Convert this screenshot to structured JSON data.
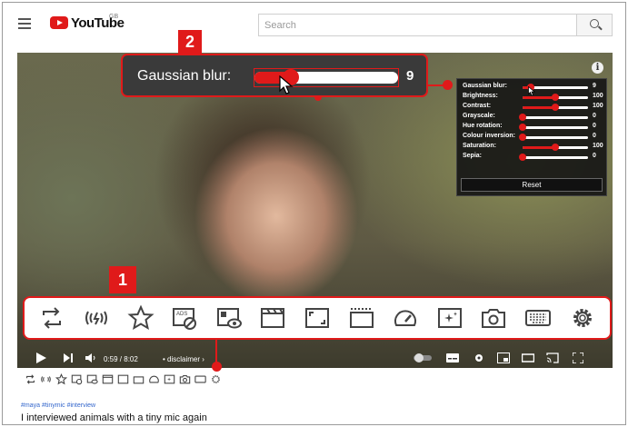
{
  "header": {
    "logo_text": "YouTube",
    "region": "GB",
    "search_placeholder": "Search"
  },
  "callouts": {
    "one": "1",
    "two": "2"
  },
  "blur_callout": {
    "label": "Gaussian blur:",
    "value": "9",
    "level_fraction": 0.25
  },
  "effects_panel": {
    "items": [
      {
        "label": "Gaussian blur:",
        "value": "9",
        "fraction": 0.12
      },
      {
        "label": "Brightness:",
        "value": "100",
        "fraction": 0.5
      },
      {
        "label": "Contrast:",
        "value": "100",
        "fraction": 0.5
      },
      {
        "label": "Grayscale:",
        "value": "0",
        "fraction": 0.0
      },
      {
        "label": "Hue rotation:",
        "value": "0",
        "fraction": 0.0
      },
      {
        "label": "Colour inversion:",
        "value": "0",
        "fraction": 0.0
      },
      {
        "label": "Saturation:",
        "value": "100",
        "fraction": 0.5
      },
      {
        "label": "Sepia:",
        "value": "0",
        "fraction": 0.0
      }
    ],
    "reset_label": "Reset"
  },
  "toolbar_icons": [
    "loop-icon",
    "broadcast-icon",
    "star-icon",
    "ads-block-icon",
    "cinema-mode-icon",
    "clapperboard-icon",
    "fullscreen-window-icon",
    "mini-player-icon",
    "speed-icon",
    "effects-icon",
    "screenshot-icon",
    "keyboard-icon",
    "settings-gear-icon"
  ],
  "player": {
    "time": "0:59 / 8:02",
    "chapter": "• disclaimer ›"
  },
  "video": {
    "tags": "#maya #tinymic #interview",
    "title": "I interviewed animals with a tiny mic again"
  },
  "colors": {
    "accent": "#e01a1a"
  }
}
